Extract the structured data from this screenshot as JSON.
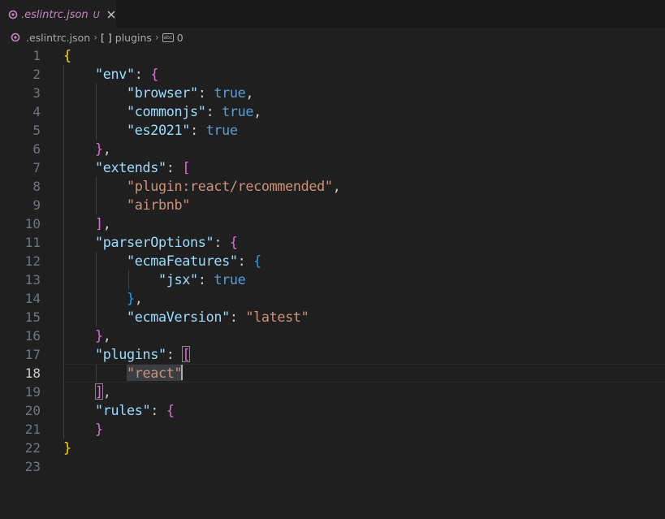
{
  "tab": {
    "title": ".eslintrc.json",
    "status": "U",
    "accent_color": "#c586c0",
    "icon": "gear-icon"
  },
  "breadcrumb": {
    "file": ".eslintrc.json",
    "bracket_symbol": "[ ]",
    "symbol": "plugins",
    "item_icon": "symbol-string-icon",
    "item": "0"
  },
  "editor": {
    "current_line": 18,
    "lines": [
      {
        "n": "1",
        "parts": [
          [
            "b-gold",
            "{"
          ]
        ]
      },
      {
        "n": "2",
        "parts": [
          [
            "tk-p",
            "    "
          ],
          [
            "tk-key",
            "\"env\""
          ],
          [
            "tk-p",
            ": "
          ],
          [
            "b-purple",
            "{"
          ]
        ]
      },
      {
        "n": "3",
        "parts": [
          [
            "tk-p",
            "        "
          ],
          [
            "tk-key",
            "\"browser\""
          ],
          [
            "tk-p",
            ": "
          ],
          [
            "tk-bool",
            "true"
          ],
          [
            "tk-p",
            ","
          ]
        ]
      },
      {
        "n": "4",
        "parts": [
          [
            "tk-p",
            "        "
          ],
          [
            "tk-key",
            "\"commonjs\""
          ],
          [
            "tk-p",
            ": "
          ],
          [
            "tk-bool",
            "true"
          ],
          [
            "tk-p",
            ","
          ]
        ]
      },
      {
        "n": "5",
        "parts": [
          [
            "tk-p",
            "        "
          ],
          [
            "tk-key",
            "\"es2021\""
          ],
          [
            "tk-p",
            ": "
          ],
          [
            "tk-bool",
            "true"
          ]
        ]
      },
      {
        "n": "6",
        "parts": [
          [
            "tk-p",
            "    "
          ],
          [
            "b-purple",
            "}"
          ],
          [
            "tk-p",
            ","
          ]
        ]
      },
      {
        "n": "7",
        "parts": [
          [
            "tk-p",
            "    "
          ],
          [
            "tk-key",
            "\"extends\""
          ],
          [
            "tk-p",
            ": "
          ],
          [
            "b-purple",
            "["
          ]
        ]
      },
      {
        "n": "8",
        "parts": [
          [
            "tk-p",
            "        "
          ],
          [
            "tk-str",
            "\"plugin:react/recommended\""
          ],
          [
            "tk-p",
            ","
          ]
        ]
      },
      {
        "n": "9",
        "parts": [
          [
            "tk-p",
            "        "
          ],
          [
            "tk-str",
            "\"airbnb\""
          ]
        ]
      },
      {
        "n": "10",
        "parts": [
          [
            "tk-p",
            "    "
          ],
          [
            "b-purple",
            "]"
          ],
          [
            "tk-p",
            ","
          ]
        ]
      },
      {
        "n": "11",
        "parts": [
          [
            "tk-p",
            "    "
          ],
          [
            "tk-key",
            "\"parserOptions\""
          ],
          [
            "tk-p",
            ": "
          ],
          [
            "b-purple",
            "{"
          ]
        ]
      },
      {
        "n": "12",
        "parts": [
          [
            "tk-p",
            "        "
          ],
          [
            "tk-key",
            "\"ecmaFeatures\""
          ],
          [
            "tk-p",
            ": "
          ],
          [
            "b-blue",
            "{"
          ]
        ]
      },
      {
        "n": "13",
        "parts": [
          [
            "tk-p",
            "            "
          ],
          [
            "tk-key",
            "\"jsx\""
          ],
          [
            "tk-p",
            ": "
          ],
          [
            "tk-bool",
            "true"
          ]
        ]
      },
      {
        "n": "14",
        "parts": [
          [
            "tk-p",
            "        "
          ],
          [
            "b-blue",
            "}"
          ],
          [
            "tk-p",
            ","
          ]
        ]
      },
      {
        "n": "15",
        "parts": [
          [
            "tk-p",
            "        "
          ],
          [
            "tk-key",
            "\"ecmaVersion\""
          ],
          [
            "tk-p",
            ": "
          ],
          [
            "tk-str",
            "\"latest\""
          ]
        ]
      },
      {
        "n": "16",
        "parts": [
          [
            "tk-p",
            "    "
          ],
          [
            "b-purple",
            "}"
          ],
          [
            "tk-p",
            ","
          ]
        ]
      },
      {
        "n": "17",
        "parts": [
          [
            "tk-p",
            "    "
          ],
          [
            "tk-key",
            "\"plugins\""
          ],
          [
            "tk-p",
            ": "
          ],
          [
            "b-purple match",
            "["
          ]
        ]
      },
      {
        "n": "18",
        "parts": [
          [
            "tk-p",
            "        "
          ],
          [
            "tk-str sel",
            "\"react\""
          ],
          [
            "cursor",
            ""
          ]
        ]
      },
      {
        "n": "19",
        "parts": [
          [
            "tk-p",
            "    "
          ],
          [
            "b-purple match",
            "]"
          ],
          [
            "tk-p",
            ","
          ]
        ]
      },
      {
        "n": "20",
        "parts": [
          [
            "tk-p",
            "    "
          ],
          [
            "tk-key",
            "\"rules\""
          ],
          [
            "tk-p",
            ": "
          ],
          [
            "b-purple",
            "{"
          ]
        ]
      },
      {
        "n": "21",
        "parts": [
          [
            "tk-p",
            "    "
          ],
          [
            "b-purple",
            "}"
          ]
        ]
      },
      {
        "n": "22",
        "parts": [
          [
            "b-gold",
            "}"
          ]
        ]
      },
      {
        "n": "23",
        "parts": []
      }
    ]
  }
}
